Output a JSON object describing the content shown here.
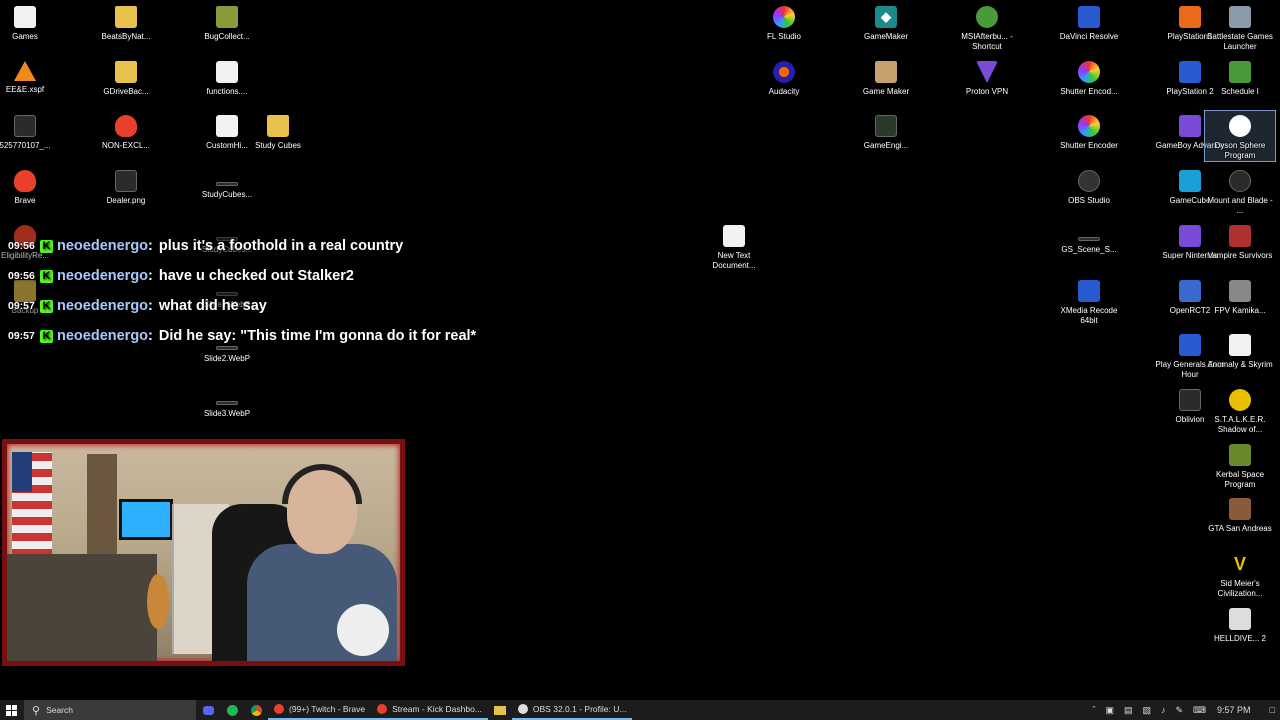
{
  "desktop": {
    "left_icons": [
      {
        "label": "Games",
        "icon": "text-file-icon"
      },
      {
        "label": "BeatsByNat...",
        "icon": "folder-icon"
      },
      {
        "label": "BugCollect...",
        "icon": "folder-icon"
      },
      {
        "label": "EE&E.xspf",
        "icon": "vlc-icon"
      },
      {
        "label": "GDriveBac...",
        "icon": "folder-icon"
      },
      {
        "label": "functions....",
        "icon": "text-file-icon"
      },
      {
        "label": "525770107_...",
        "icon": "image-file-icon"
      },
      {
        "label": "NON-EXCL...",
        "icon": "brave-icon"
      },
      {
        "label": "CustomHi...",
        "icon": "text-file-icon"
      },
      {
        "label": "Study Cubes",
        "icon": "folder-icon"
      },
      {
        "label": "Brave",
        "icon": "brave-icon"
      },
      {
        "label": "Dealer.png",
        "icon": "image-file-icon"
      },
      {
        "label": "StudyCubes...",
        "icon": "image-file-icon"
      },
      {
        "label": "EligibilityRe...",
        "icon": "brave-icon"
      },
      {
        "label": "StudyCubes...",
        "icon": "image-file-icon"
      },
      {
        "label": "Backup",
        "icon": "folder-icon"
      },
      {
        "label": "Slide1.WebP",
        "icon": "image-file-icon"
      },
      {
        "label": "Slide2.WebP",
        "icon": "image-file-icon"
      },
      {
        "label": "Slide3.WebP",
        "icon": "image-file-icon"
      }
    ],
    "middle_icons": [
      {
        "label": "New Text Document...",
        "icon": "text-file-icon"
      }
    ],
    "right_icons": [
      {
        "label": "FL Studio",
        "icon": "fl-studio-icon"
      },
      {
        "label": "GameMaker",
        "icon": "gamemaker-icon"
      },
      {
        "label": "MSIAfterbu... - Shortcut",
        "icon": "msi-afterburner-icon"
      },
      {
        "label": "DaVinci Resolve",
        "icon": "davinci-resolve-icon"
      },
      {
        "label": "PlayStation1",
        "icon": "playstation-icon"
      },
      {
        "label": "Battlestate Games Launcher",
        "icon": "battlestate-icon"
      },
      {
        "label": "Audacity",
        "icon": "audacity-icon"
      },
      {
        "label": "Game Maker",
        "icon": "gamemaker-icon"
      },
      {
        "label": "Proton VPN",
        "icon": "proton-vpn-icon"
      },
      {
        "label": "Shutter Encod...",
        "icon": "shutter-encoder-icon"
      },
      {
        "label": "PlayStation 2",
        "icon": "playstation-icon"
      },
      {
        "label": "Schedule I",
        "icon": "schedule-i-icon"
      },
      {
        "label": "GameEngi...",
        "icon": "game-engine-icon"
      },
      {
        "label": "Shutter Encoder",
        "icon": "shutter-encoder-icon"
      },
      {
        "label": "GameBoy Advance",
        "icon": "gameboy-icon"
      },
      {
        "label": "Dyson Sphere Program",
        "icon": "dyson-sphere-icon"
      },
      {
        "label": "OBS Studio",
        "icon": "obs-icon"
      },
      {
        "label": "GameCube",
        "icon": "gamecube-icon"
      },
      {
        "label": "Mount and Blade - ...",
        "icon": "mount-blade-icon"
      },
      {
        "label": "GS_Scene_S...",
        "icon": "image-file-icon"
      },
      {
        "label": "Super Nintendo",
        "icon": "snes-icon"
      },
      {
        "label": "Vampire Survivors",
        "icon": "vampire-survivors-icon"
      },
      {
        "label": "XMedia Recode 64bit",
        "icon": "xmedia-recode-icon"
      },
      {
        "label": "OpenRCT2",
        "icon": "openrct2-icon"
      },
      {
        "label": "FPV Kamika...",
        "icon": "fpv-kamikaze-icon"
      },
      {
        "label": "Play Generals Zero Hour",
        "icon": "generals-icon"
      },
      {
        "label": "Anomaly & Skyrim",
        "icon": "text-file-icon"
      },
      {
        "label": "Oblivion",
        "icon": "oblivion-icon"
      },
      {
        "label": "S.T.A.L.K.E.R. Shadow of...",
        "icon": "stalker-icon"
      },
      {
        "label": "Kerbal Space Program",
        "icon": "kerbal-icon"
      },
      {
        "label": "GTA San Andreas",
        "icon": "gta-icon"
      },
      {
        "label": "Sid Meier's Civilization...",
        "icon": "civilization-icon"
      },
      {
        "label": "HELLDIVE... 2",
        "icon": "helldivers-icon"
      }
    ]
  },
  "chat": {
    "messages": [
      {
        "time": "09:56",
        "user": "neoedenergo",
        "sep": ":",
        "text": "plus it's a foothold in a real country"
      },
      {
        "time": "09:56",
        "user": "neoedenergo",
        "sep": ":",
        "text": "have u checked out Stalker2"
      },
      {
        "time": "09:57",
        "user": "neoedenergo",
        "sep": ":",
        "text": "what did he say"
      },
      {
        "time": "09:57",
        "user": "neoedenergo",
        "sep": ":",
        "text": "Did he say: \"This time I'm gonna do it for real*"
      }
    ],
    "badge": "K"
  },
  "taskbar": {
    "search_placeholder": "Search",
    "apps": [
      {
        "label": "(99+) Twitch - Brave",
        "color": "#e8402a"
      },
      {
        "label": "Stream - Kick Dashbo...",
        "color": "#e8402a"
      },
      {
        "label": "OBS 32.0.1 - Profile: U...",
        "color": "#dddddd"
      }
    ],
    "clock": "9:57 PM"
  },
  "colors": {
    "chat_user": "#a9c8ff",
    "kick_badge": "#53fc18",
    "webcam_border": "#7a0f0f",
    "taskbar_bg": "#1c1c1c"
  }
}
